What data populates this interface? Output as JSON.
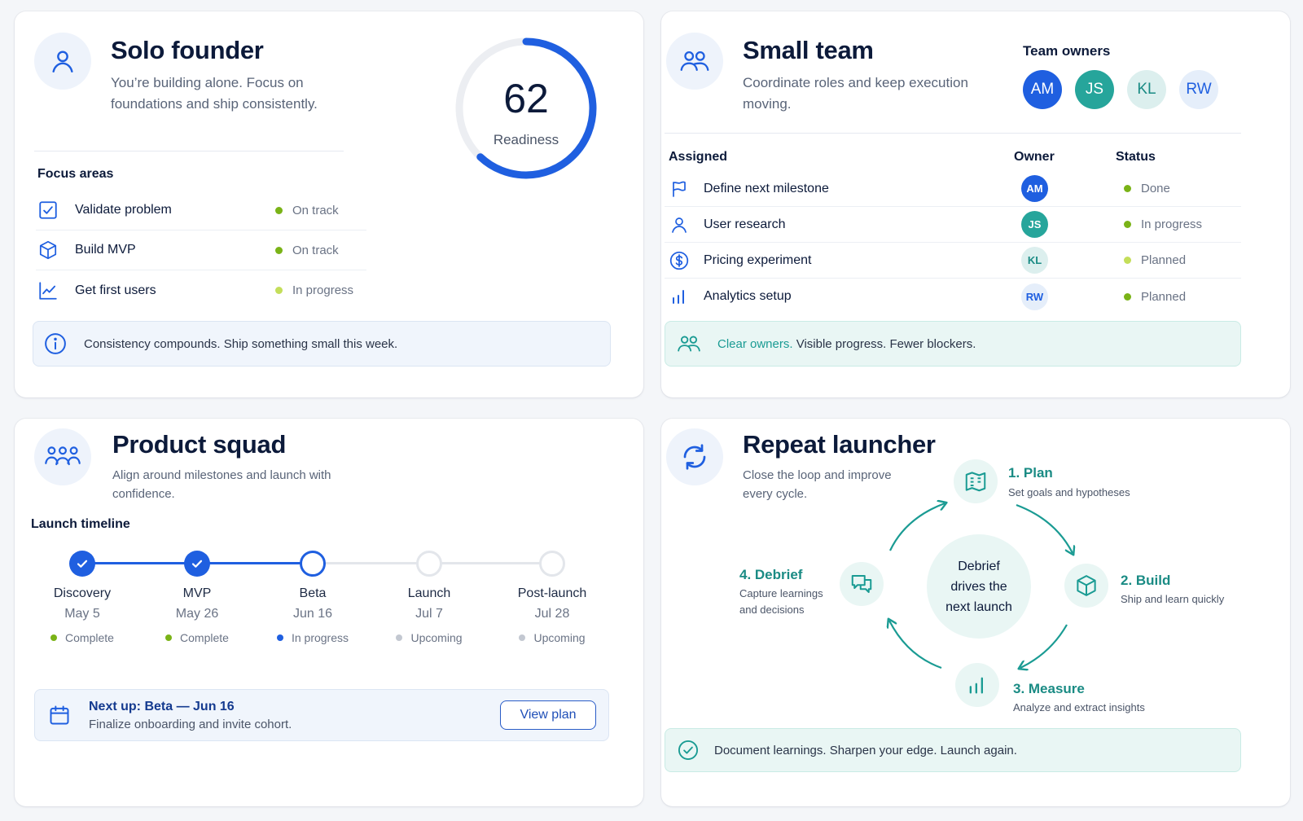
{
  "solo": {
    "title": "Solo founder",
    "subtitle_line1": "You’re building alone. Focus on",
    "subtitle_line2": "foundations and ship consistently.",
    "readiness_value": "62",
    "readiness_fraction": 0.62,
    "readiness_label": "Readiness",
    "focus_label": "Focus areas",
    "focus": [
      {
        "label": "Validate problem",
        "status": "On track",
        "icon": "checkbox-icon"
      },
      {
        "label": "Build MVP",
        "status": "On track",
        "icon": "cube-icon"
      },
      {
        "label": "Get first users",
        "status": "In progress",
        "icon": "trend-chart-icon"
      }
    ],
    "tip": "Consistency compounds. Ship something small this week."
  },
  "team": {
    "title": "Small team",
    "subtitle_line1": "Coordinate roles and keep execution",
    "subtitle_line2": "moving.",
    "owners_label": "Team owners",
    "owners": [
      "AM",
      "JS",
      "KL",
      "RW"
    ],
    "col_assigned": "Assigned",
    "col_owner": "Owner",
    "col_status": "Status",
    "tasks": [
      {
        "label": "Define next milestone",
        "owner": "AM",
        "status": "Done",
        "icon": "flag-icon"
      },
      {
        "label": "User research",
        "owner": "JS",
        "status": "In progress",
        "icon": "user-icon"
      },
      {
        "label": "Pricing experiment",
        "owner": "KL",
        "status": "Planned",
        "icon": "dollar-icon"
      },
      {
        "label": "Analytics setup",
        "owner": "RW",
        "status": "Planned",
        "icon": "bar-chart-icon"
      }
    ],
    "banner_highlight": "Clear owners.",
    "banner_rest": " Visible progress. Fewer blockers."
  },
  "squad": {
    "title": "Product squad",
    "subtitle_line1": "Align around milestones and launch with",
    "subtitle_line2": "confidence.",
    "timeline_label": "Launch timeline",
    "milestones": [
      {
        "name": "Discovery",
        "date": "May 5",
        "status": "Complete"
      },
      {
        "name": "MVP",
        "date": "May 26",
        "status": "Complete"
      },
      {
        "name": "Beta",
        "date": "Jun 16",
        "status": "In progress"
      },
      {
        "name": "Launch",
        "date": "Jul 7",
        "status": "Upcoming"
      },
      {
        "name": "Post-launch",
        "date": "Jul 28",
        "status": "Upcoming"
      }
    ],
    "next_title": "Next up: Beta — Jun 16",
    "next_desc": "Finalize onboarding and invite cohort.",
    "view_plan": "View plan"
  },
  "repeat": {
    "title": "Repeat launcher",
    "subtitle_line1": "Close the loop and improve",
    "subtitle_line2": "every cycle.",
    "center_line1": "Debrief",
    "center_line2": "drives the",
    "center_line3": "next launch",
    "steps": [
      {
        "title": "1. Plan",
        "desc": "Set goals and hypotheses",
        "icon": "map-icon"
      },
      {
        "title": "2. Build",
        "desc": "Ship and learn quickly",
        "icon": "cube-icon"
      },
      {
        "title": "3. Measure",
        "desc": "Analyze and extract insights",
        "icon": "bar-chart-icon"
      },
      {
        "title": "4. Debrief",
        "desc_line1": "Capture learnings",
        "desc_line2": "and decisions",
        "icon": "chat-icon"
      }
    ],
    "banner": "Document learnings. Sharpen your edge. Launch again."
  },
  "colors": {
    "primary_blue": "#1f5fe0",
    "teal": "#1a9b93",
    "on_track_green": "#7ab317",
    "in_progress_lime": "#b7d94a",
    "upcoming_gray": "#c3c8d1"
  }
}
